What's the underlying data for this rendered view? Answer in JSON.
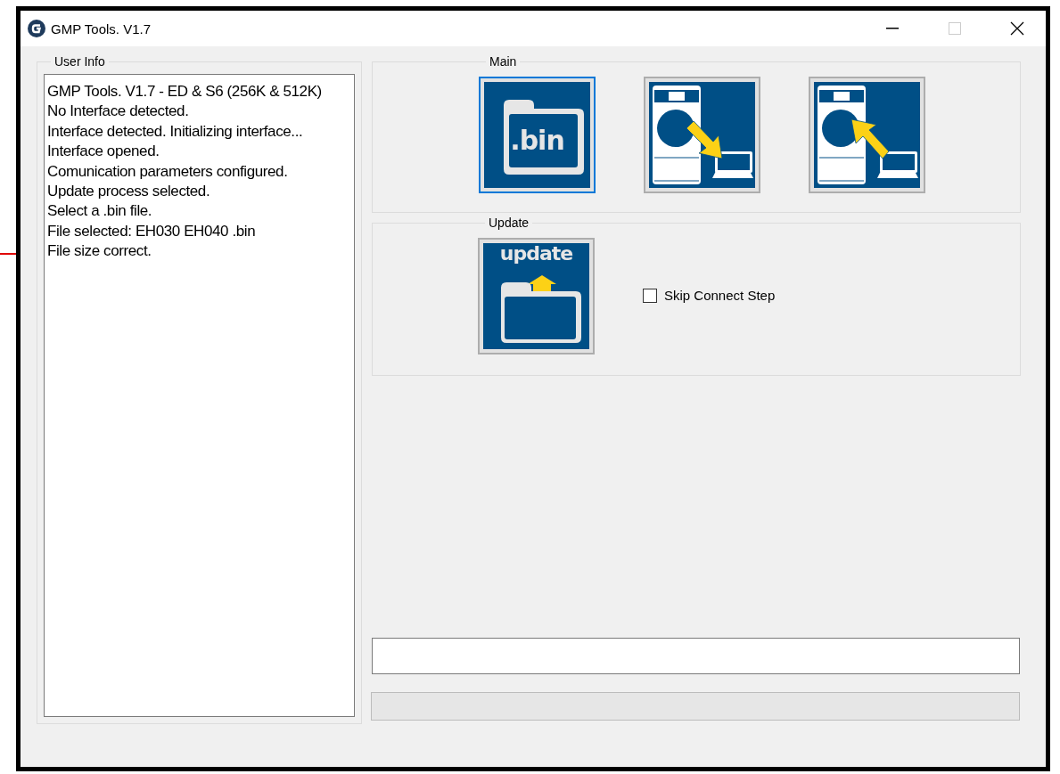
{
  "window": {
    "title": "GMP Tools. V1.7"
  },
  "user_info": {
    "title": "User Info",
    "lines": [
      "GMP Tools. V1.7 - ED & S6 (256K & 512K)",
      "No Interface detected.",
      "Interface detected. Initializing interface...",
      "Interface opened.",
      "Comunication parameters configured.",
      "Update process selected.",
      "Select a .bin file.",
      "File selected: EH030 EH040 .bin",
      "File size correct."
    ]
  },
  "main": {
    "title": "Main",
    "buttons": [
      {
        "kind": "bin",
        "label": ".bin",
        "selected": true
      },
      {
        "kind": "download",
        "selected": false
      },
      {
        "kind": "upload",
        "selected": false
      }
    ]
  },
  "update": {
    "title": "Update",
    "button": {
      "label": "update"
    },
    "skip_connect": {
      "label": "Skip Connect Step",
      "checked": false
    }
  }
}
